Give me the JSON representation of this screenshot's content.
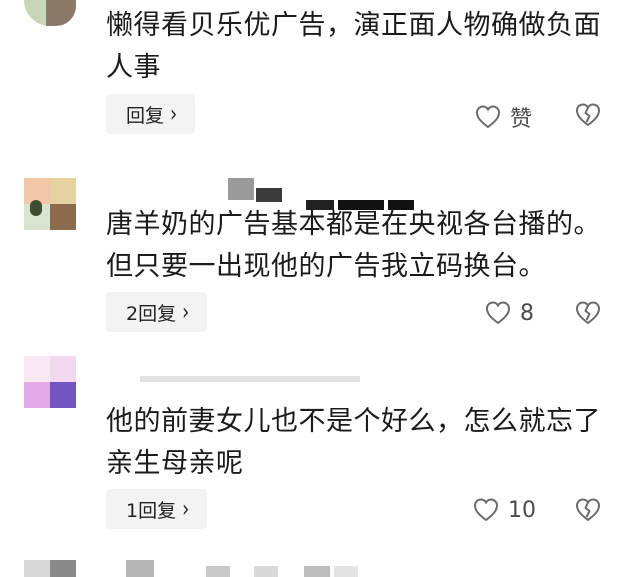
{
  "comments": [
    {
      "text": "懒得看贝乐优广告，演正面人物确做负面人事",
      "reply_label": "回复",
      "like_text": "赞"
    },
    {
      "text": "唐羊奶的广告基本都是在央视各台播的。但只要一出现他的广告我立码换台。",
      "reply_label": "2回复",
      "like_text": "8"
    },
    {
      "text": "他的前妻女儿也不是个好么，怎么就忘了亲生母亲呢",
      "reply_label": "1回复",
      "like_text": "10"
    }
  ],
  "icons": {
    "like": "heart-outline-icon",
    "dislike": "broken-heart-icon",
    "reply_chevron": "chevron-right-icon"
  },
  "colors": {
    "reply_bg": "#f3f3f3",
    "icon_stroke": "#6b6b6b",
    "text": "#1b1b1b"
  }
}
